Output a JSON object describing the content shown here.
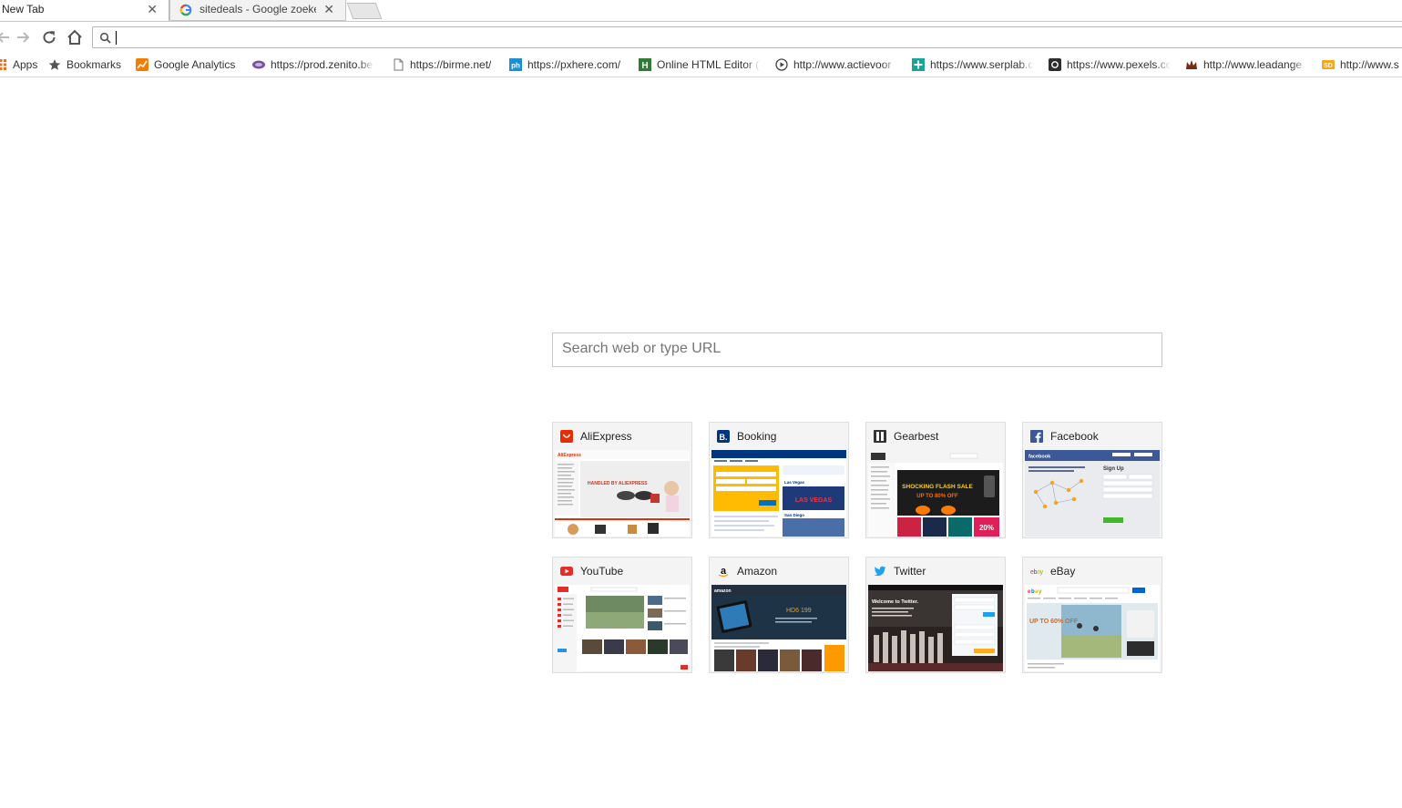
{
  "tabs": [
    {
      "title": "New Tab",
      "active": true
    },
    {
      "title": "sitedeals - Google zoeke",
      "active": false
    }
  ],
  "toolbar": {
    "address_value": ""
  },
  "bookmarks": [
    {
      "label": "Apps",
      "icon": "apps-grid-icon"
    },
    {
      "label": "Bookmarks",
      "icon": "star-icon"
    },
    {
      "label": "Google Analytics",
      "icon": "analytics-icon"
    },
    {
      "label": "https://prod.zenito.be",
      "icon": "zenito-icon"
    },
    {
      "label": "https://birme.net/",
      "icon": "page-icon"
    },
    {
      "label": "https://pxhere.com/",
      "icon": "pxhere-icon"
    },
    {
      "label": "Online HTML Editor (",
      "icon": "html-editor-icon"
    },
    {
      "label": "http://www.actievoor",
      "icon": "play-circle-icon"
    },
    {
      "label": "https://www.serplab.c",
      "icon": "serplab-icon"
    },
    {
      "label": "https://www.pexels.co",
      "icon": "camera-icon"
    },
    {
      "label": "http://www.leadange",
      "icon": "crown-icon"
    },
    {
      "label": "http://www.s",
      "icon": "sd-icon"
    }
  ],
  "search": {
    "placeholder": "Search web or type URL"
  },
  "tiles": [
    {
      "title": "AliExpress",
      "icon": "aliexpress-icon",
      "color": "#e62e04"
    },
    {
      "title": "Booking",
      "icon": "booking-icon",
      "color": "#003580"
    },
    {
      "title": "Gearbest",
      "icon": "gearbest-icon",
      "color": "#333333"
    },
    {
      "title": "Facebook",
      "icon": "facebook-icon",
      "color": "#3b5998"
    },
    {
      "title": "YouTube",
      "icon": "youtube-icon",
      "color": "#e52d27"
    },
    {
      "title": "Amazon",
      "icon": "amazon-icon",
      "color": "#232f3e"
    },
    {
      "title": "Twitter",
      "icon": "twitter-icon",
      "color": "#1da1f2"
    },
    {
      "title": "eBay",
      "icon": "ebay-icon",
      "color": "#e53238"
    }
  ],
  "thumbs": {
    "aliexpress": {
      "banner": "HANDLED BY ALIEXPRESS"
    },
    "booking": {
      "banner": "LAS VEGAS",
      "city1": "Las Vegas",
      "city2": "San Diego"
    },
    "gearbest": {
      "banner": "SHOCKING FLASH SALE",
      "sub": "UP TO 80% OFF",
      "pct": "20%"
    },
    "facebook": {
      "brand": "facebook",
      "signup": "Sign Up"
    },
    "amazon": {
      "brand": "amazon",
      "product": "HD6 199"
    },
    "twitter": {
      "welcome": "Welcome to Twitter."
    },
    "ebay": {
      "promo": "UP TO 60% OFF"
    }
  }
}
